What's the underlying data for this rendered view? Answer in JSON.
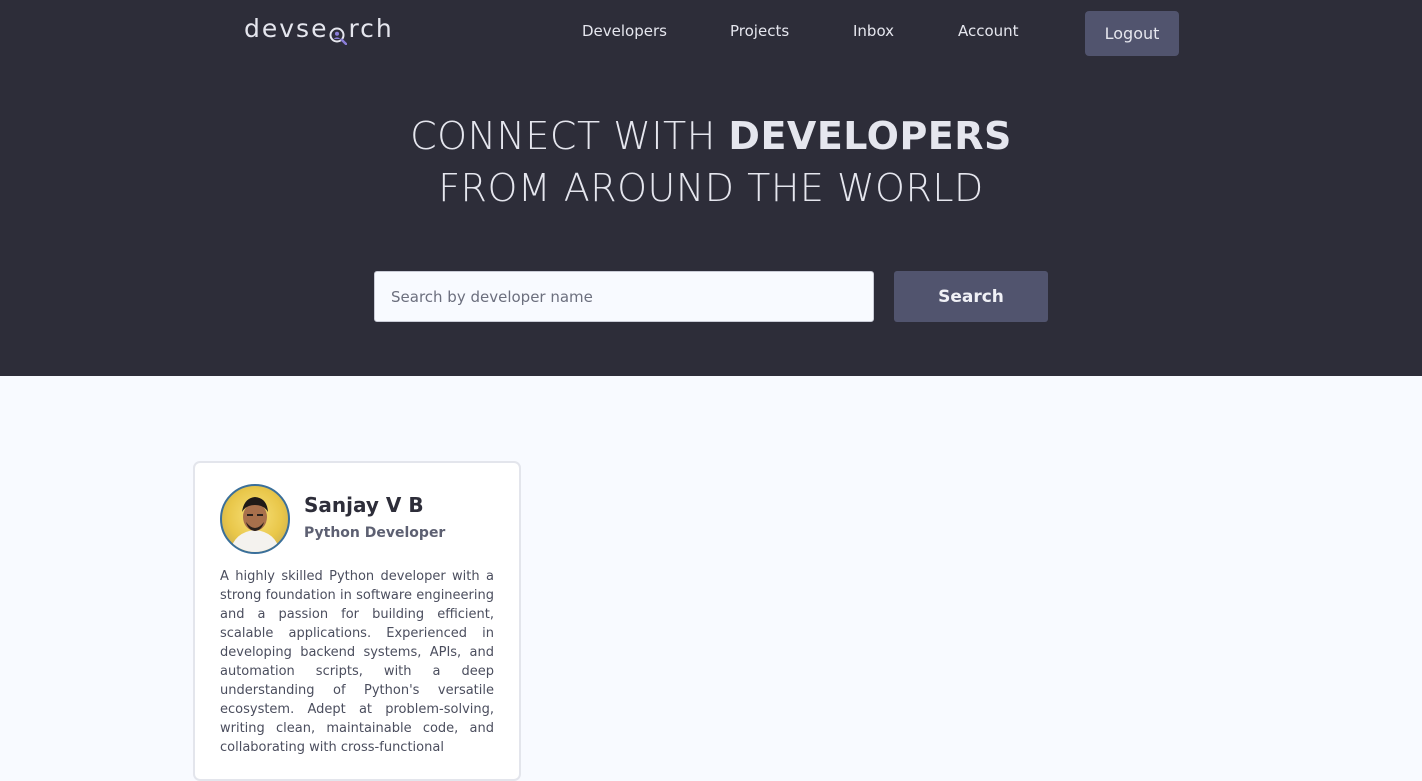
{
  "nav": {
    "logo_text_1": "devse",
    "logo_text_2": "rch",
    "items": [
      {
        "label": "Developers"
      },
      {
        "label": "Projects"
      },
      {
        "label": "Inbox"
      },
      {
        "label": "Account"
      }
    ],
    "logout_label": "Logout"
  },
  "hero": {
    "line1_light": "CONNECT WITH ",
    "line1_bold": "DEVELOPERS",
    "line2": "FROM AROUND THE WORLD",
    "search_placeholder": "Search by developer name",
    "search_button": "Search"
  },
  "profiles": [
    {
      "name": "Sanjay V B",
      "role": "Python Developer",
      "bio": "A highly skilled Python developer with a strong foundation in software engineering and a passion for building efficient, scalable applications. Experienced in developing backend systems, APIs, and automation scripts, with a deep understanding of Python's versatile ecosystem. Adept at problem-solving, writing clean, maintainable code, and collaborating with cross-functional"
    }
  ],
  "colors": {
    "hero_bg": "#2d2d39",
    "accent": "#51546e",
    "page_bg": "#f8faff"
  }
}
